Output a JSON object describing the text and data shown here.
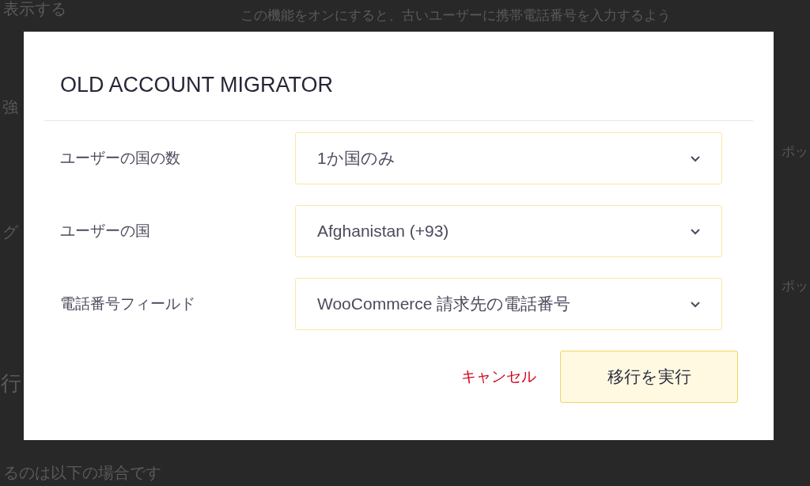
{
  "background_texts": [
    {
      "text": "表示する",
      "kind": "heading"
    },
    {
      "text": "この機能をオンにすると、古いユーザーに携帯電話番号を入力するよう",
      "kind": "body"
    },
    {
      "text": "強",
      "kind": "heading"
    },
    {
      "text": "ポッ",
      "kind": "body"
    },
    {
      "text": "グ",
      "kind": "heading"
    },
    {
      "text": "ポッ",
      "kind": "body"
    },
    {
      "text": "行",
      "kind": "title"
    },
    {
      "text": "るのは以下の場合です",
      "kind": "heading"
    }
  ],
  "dialog": {
    "title": "OLD ACCOUNT MIGRATOR",
    "fields": [
      {
        "label": "ユーザーの国の数",
        "value": "1か国のみ"
      },
      {
        "label": "ユーザーの国",
        "value": "Afghanistan (+93)"
      },
      {
        "label": "電話番号フィールド",
        "value": "WooCommerce 請求先の電話番号"
      }
    ],
    "buttons": [
      {
        "label": "キャンセル",
        "kind": "link"
      },
      {
        "label": "移行を実行",
        "kind": "primary"
      }
    ]
  }
}
